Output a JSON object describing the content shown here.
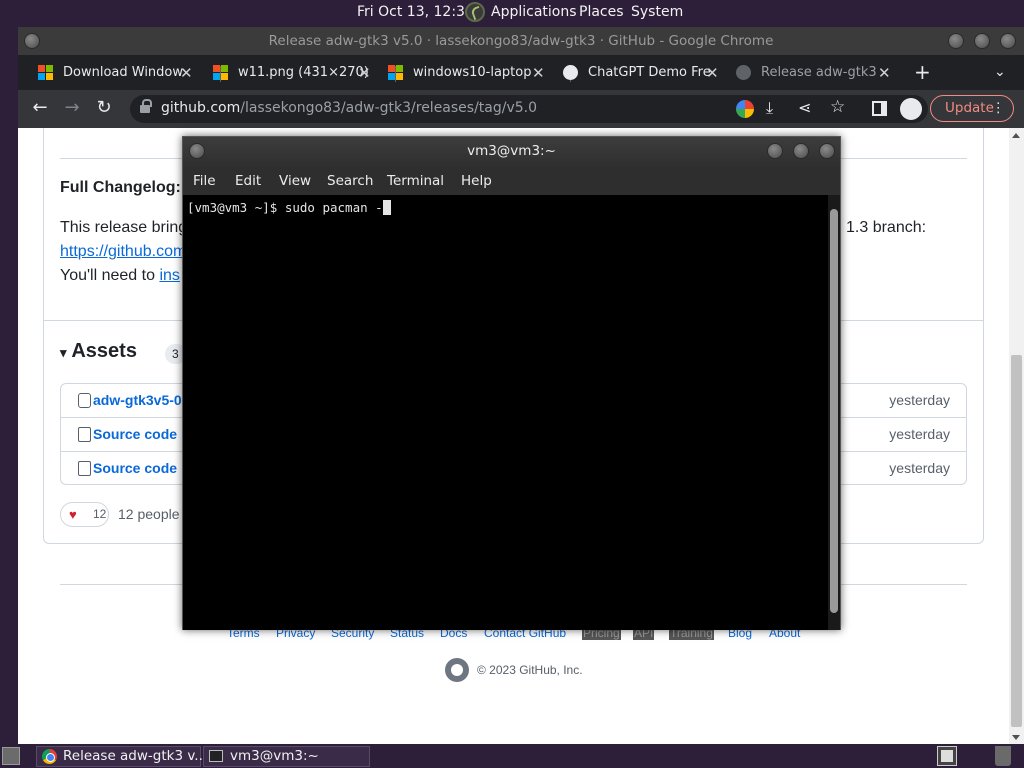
{
  "top_panel": {
    "clock": "Fri Oct 13, 12:30",
    "menus": [
      "Applications",
      "Places",
      "System"
    ]
  },
  "chrome": {
    "window_title": "Release adw-gtk3 v5.0 · lassekongo83/adw-gtk3 · GitHub - Google Chrome",
    "tabs": [
      {
        "title": "Download Window",
        "favicon": "microsoft-logo-icon"
      },
      {
        "title": "w11.png (431×270)",
        "favicon": "microsoft-logo-icon"
      },
      {
        "title": "windows10-laptop",
        "favicon": "microsoft-logo-icon"
      },
      {
        "title": "ChatGPT Demo Fre",
        "favicon": "globe-icon"
      },
      {
        "title": "Release adw-gtk3",
        "favicon": "github-icon"
      }
    ],
    "url_host": "github.com",
    "url_path": "/lassekongo83/adw-gtk3/releases/tag/v5.0",
    "update_label": "Update"
  },
  "page": {
    "changelog_label": "Full Changelog:",
    "release_text_start": "This release bring",
    "release_text_end": "1.3 branch:",
    "link_partial": "https://github.com",
    "need_text": "You'll need to ",
    "need_link": "ins",
    "assets_title": "Assets",
    "assets_count": "3",
    "assets": [
      {
        "name": "adw-gtk3v5-0",
        "date": "yesterday"
      },
      {
        "name": "Source code",
        "date": "yesterday"
      },
      {
        "name": "Source code",
        "date": "yesterday"
      }
    ],
    "reaction_count": "12",
    "reaction_text": "12 people",
    "footer_links": [
      "Terms",
      "Privacy",
      "Security",
      "Status",
      "Docs",
      "Contact GitHub",
      "Pricing",
      "API",
      "Training",
      "Blog",
      "About"
    ],
    "copyright": "© 2023 GitHub, Inc."
  },
  "terminal": {
    "title": "vm3@vm3:~",
    "menus": [
      "File",
      "Edit",
      "View",
      "Search",
      "Terminal",
      "Help"
    ],
    "prompt_line": "[vm3@vm3 ~]$ sudo pacman -"
  },
  "taskbar": {
    "items": [
      "Release adw-gtk3 v...",
      "vm3@vm3:~"
    ]
  }
}
